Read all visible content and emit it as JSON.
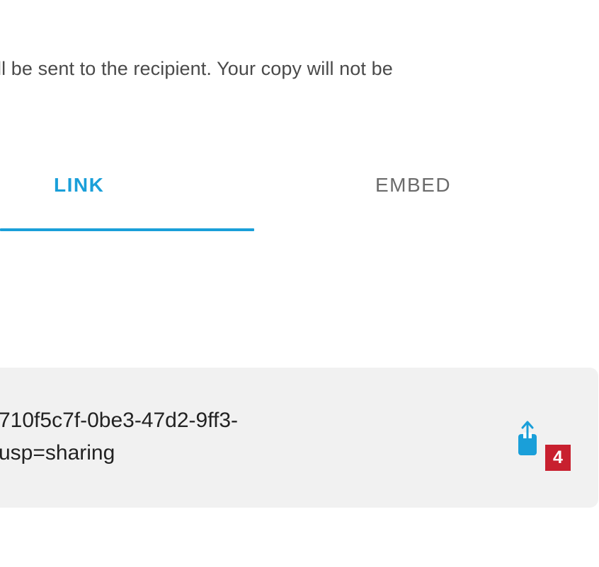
{
  "notice": {
    "text": "ll be sent to the recipient. Your copy will not be"
  },
  "tabs": [
    {
      "label": "LINK",
      "active": true
    },
    {
      "label": "EMBED",
      "active": false
    }
  ],
  "link_box": {
    "line1": "710f5c7f-0be3-47d2-9ff3-",
    "line2": "usp=sharing",
    "share_icon": "share-upload-icon"
  },
  "badge": {
    "value": "4"
  },
  "colors": {
    "accent": "#1a9fd9",
    "badge": "#c8202f",
    "box_bg": "#f1f1f1"
  }
}
